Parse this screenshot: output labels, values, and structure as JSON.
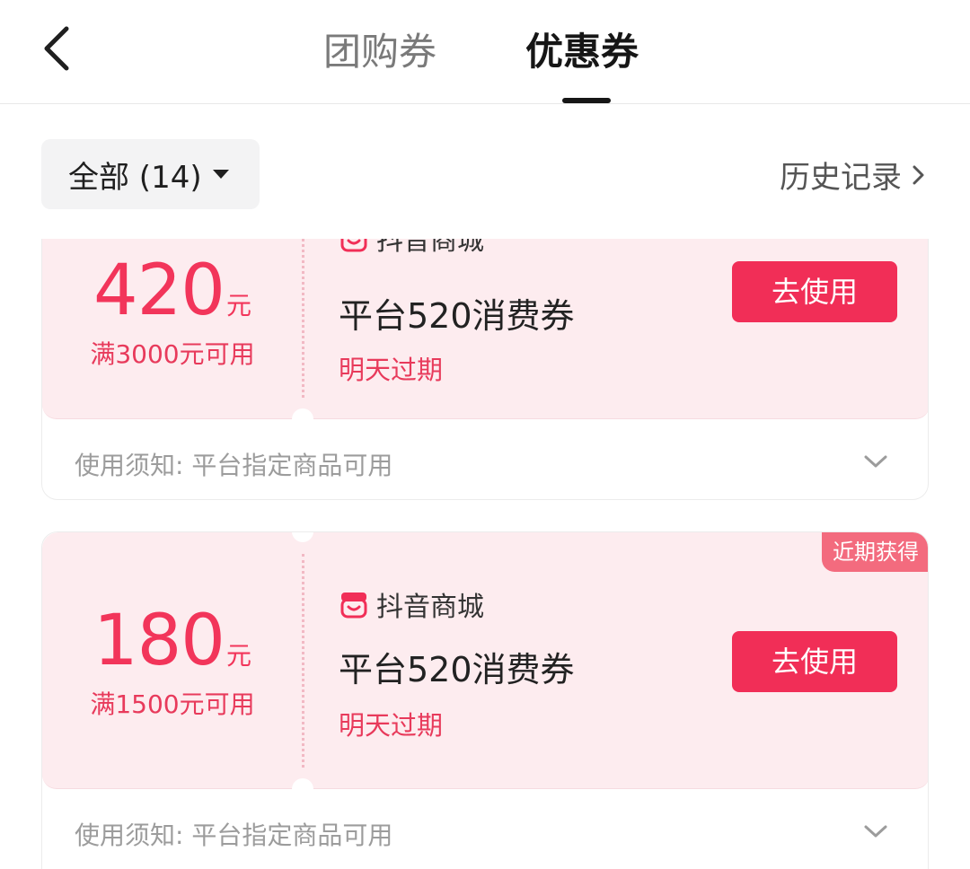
{
  "header": {
    "back_icon": "chevron-left-icon",
    "tabs": [
      {
        "label": "团购券",
        "active": false
      },
      {
        "label": "优惠券",
        "active": true
      }
    ]
  },
  "filter": {
    "label": "全部 (14)",
    "history_label": "历史记录"
  },
  "coupons": [
    {
      "amount": "420",
      "unit": "元",
      "condition": "满3000元可用",
      "shop": "抖音商城",
      "title": "平台520消费券",
      "expire": "明天过期",
      "button": "去使用",
      "badge": "",
      "notice": "使用须知: 平台指定商品可用"
    },
    {
      "amount": "180",
      "unit": "元",
      "condition": "满1500元可用",
      "shop": "抖音商城",
      "title": "平台520消费券",
      "expire": "明天过期",
      "button": "去使用",
      "badge": "近期获得",
      "notice": "使用须知: 平台指定商品可用"
    }
  ],
  "colors": {
    "accent": "#f12e57",
    "card_bg": "#fdecef",
    "price": "#f2355a"
  }
}
